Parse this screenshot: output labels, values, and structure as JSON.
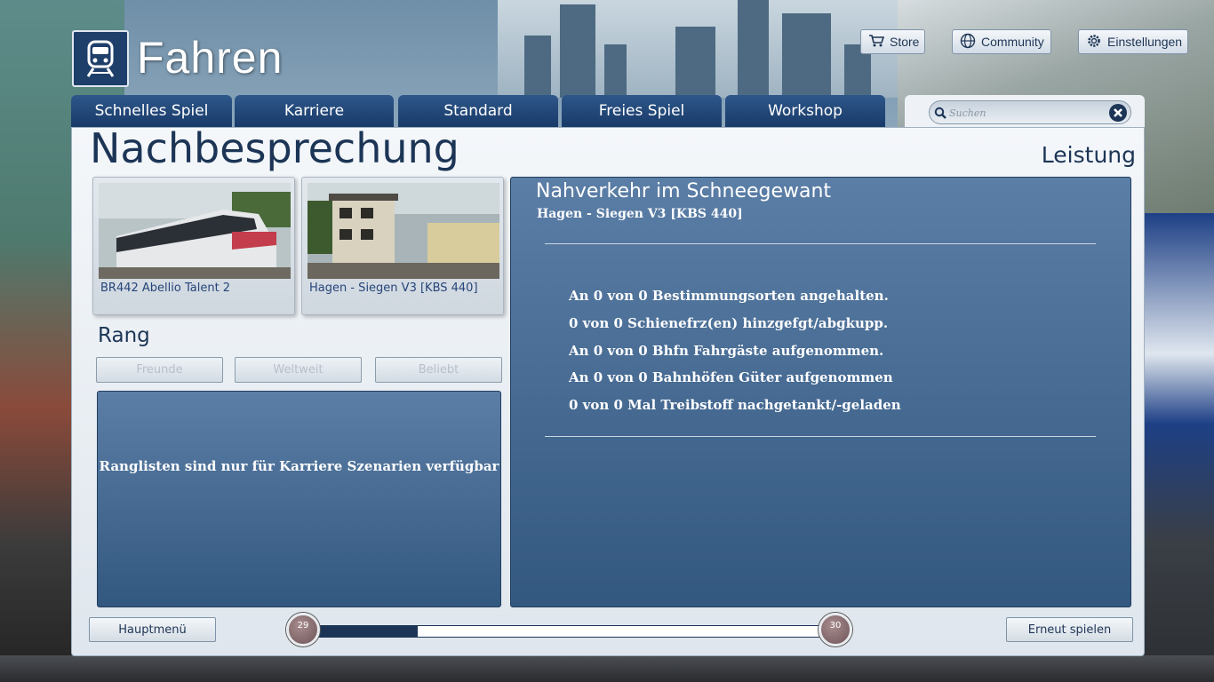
{
  "header": {
    "app_title": "Fahren",
    "store_label": "Store",
    "community_label": "Community",
    "settings_label": "Einstellungen"
  },
  "tabs": [
    {
      "label": "Schnelles Spiel"
    },
    {
      "label": "Karriere"
    },
    {
      "label": "Standard"
    },
    {
      "label": "Freies Spiel"
    },
    {
      "label": "Workshop"
    }
  ],
  "search": {
    "placeholder": "Suchen",
    "value": ""
  },
  "page": {
    "title": "Nachbesprechung",
    "right_title": "Leistung"
  },
  "cards": [
    {
      "label": "BR442 Abellio Talent 2"
    },
    {
      "label": "Hagen - Siegen V3 [KBS 440]"
    }
  ],
  "rank": {
    "title": "Rang",
    "buttons": [
      "Freunde",
      "Weltweit",
      "Beliebt"
    ],
    "message": "Ranglisten sind nur für Karriere Szenarien verfügbar"
  },
  "scenario": {
    "title": "Nahverkehr im Schneegewant",
    "route": "Hagen - Siegen V3 [KBS 440]",
    "stats": [
      "An 0 von 0 Bestimmungsorten angehalten.",
      "0 von 0 Schienefrz(en) hinzgefgt/abgkupp.",
      "An 0 von 0 Bhfn Fahrgäste aufgenommen.",
      "An 0 von 0 Bahnhöfen Güter aufgenommen",
      "0 von 0 Mal Treibstoff nachgetankt/-geladen"
    ]
  },
  "footer": {
    "main_menu_label": "Hauptmenü",
    "replay_label": "Erneut spielen",
    "level_current": "29",
    "level_next": "30",
    "progress": 0.2
  },
  "colors": {
    "accent": "#1c3556",
    "tab": "#1f426f",
    "panel": "#3f638c"
  }
}
